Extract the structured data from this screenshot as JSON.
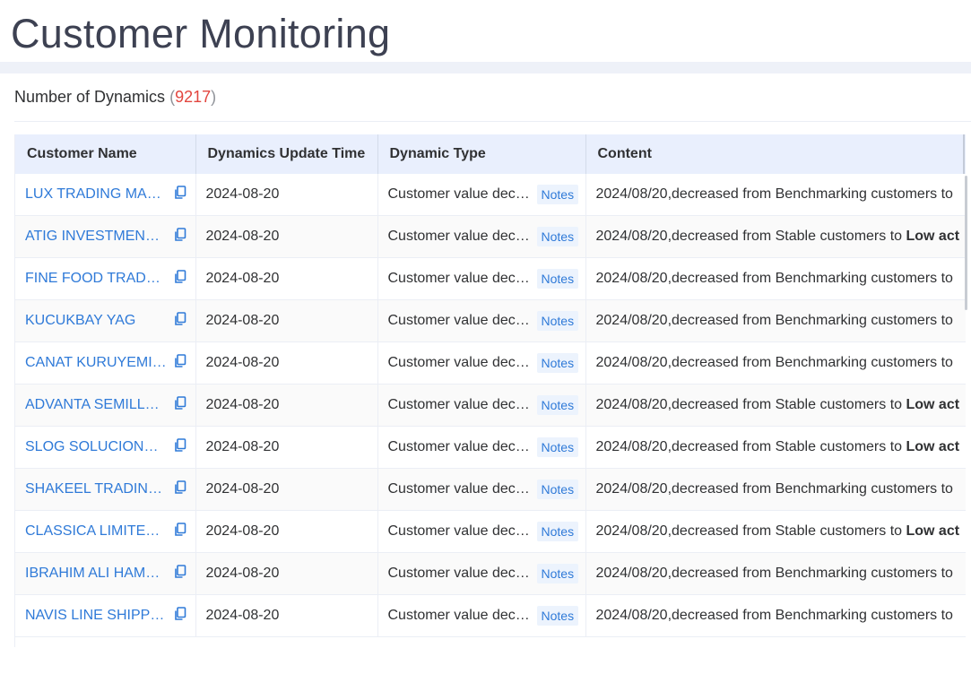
{
  "page": {
    "title": "Customer Monitoring"
  },
  "summary": {
    "label": "Number of Dynamics",
    "open": "(",
    "count": "9217",
    "close": ")"
  },
  "table": {
    "columns": [
      "Customer Name",
      "Dynamics Update Time",
      "Dynamic Type",
      "Content"
    ],
    "rows": [
      {
        "name": "LUX TRADING MAX ...",
        "time": "2024-08-20",
        "type": "Customer value decli...",
        "tag": "Notes",
        "content": "2024/08/20,decreased from Benchmarking customers to",
        "content_bold": ""
      },
      {
        "name": "ATIG INVESTMENT L...",
        "time": "2024-08-20",
        "type": "Customer value decli...",
        "tag": "Notes",
        "content": "2024/08/20,decreased from Stable customers to",
        "content_bold": "Low act"
      },
      {
        "name": "FINE FOOD TRADERS",
        "time": "2024-08-20",
        "type": "Customer value decli...",
        "tag": "Notes",
        "content": "2024/08/20,decreased from Benchmarking customers to",
        "content_bold": ""
      },
      {
        "name": "KUCUKBAY YAG",
        "time": "2024-08-20",
        "type": "Customer value decli...",
        "tag": "Notes",
        "content": "2024/08/20,decreased from Benchmarking customers to",
        "content_bold": ""
      },
      {
        "name": "CANAT KURUYEMIS ...",
        "time": "2024-08-20",
        "type": "Customer value decli...",
        "tag": "Notes",
        "content": "2024/08/20,decreased from Benchmarking customers to",
        "content_bold": ""
      },
      {
        "name": "ADVANTA SEMILLAS ...",
        "time": "2024-08-20",
        "type": "Customer value decli...",
        "tag": "Notes",
        "content": "2024/08/20,decreased from Stable customers to",
        "content_bold": "Low act"
      },
      {
        "name": "SLOG SOLUCIONES L...",
        "time": "2024-08-20",
        "type": "Customer value decli...",
        "tag": "Notes",
        "content": "2024/08/20,decreased from Stable customers to",
        "content_bold": "Low act"
      },
      {
        "name": "SHAKEEL TRADING C...",
        "time": "2024-08-20",
        "type": "Customer value decli...",
        "tag": "Notes",
        "content": "2024/08/20,decreased from Benchmarking customers to",
        "content_bold": ""
      },
      {
        "name": "CLASSICA LIMITED P...",
        "time": "2024-08-20",
        "type": "Customer value decli...",
        "tag": "Notes",
        "content": "2024/08/20,decreased from Stable customers to",
        "content_bold": "Low act"
      },
      {
        "name": "IBRAHIM ALI HAMZA...",
        "time": "2024-08-20",
        "type": "Customer value decli...",
        "tag": "Notes",
        "content": "2024/08/20,decreased from Benchmarking customers to",
        "content_bold": ""
      },
      {
        "name": "NAVIS LINE SHIPPIN...",
        "time": "2024-08-20",
        "type": "Customer value decli...",
        "tag": "Notes",
        "content": "2024/08/20,decreased from Benchmarking customers to",
        "content_bold": ""
      }
    ]
  },
  "icons": {
    "copy": "copy-icon"
  },
  "colors": {
    "link": "#2f7ad8",
    "count": "#e2463f",
    "header_bg": "#e9effd",
    "tag_bg": "#ecf3fd"
  }
}
